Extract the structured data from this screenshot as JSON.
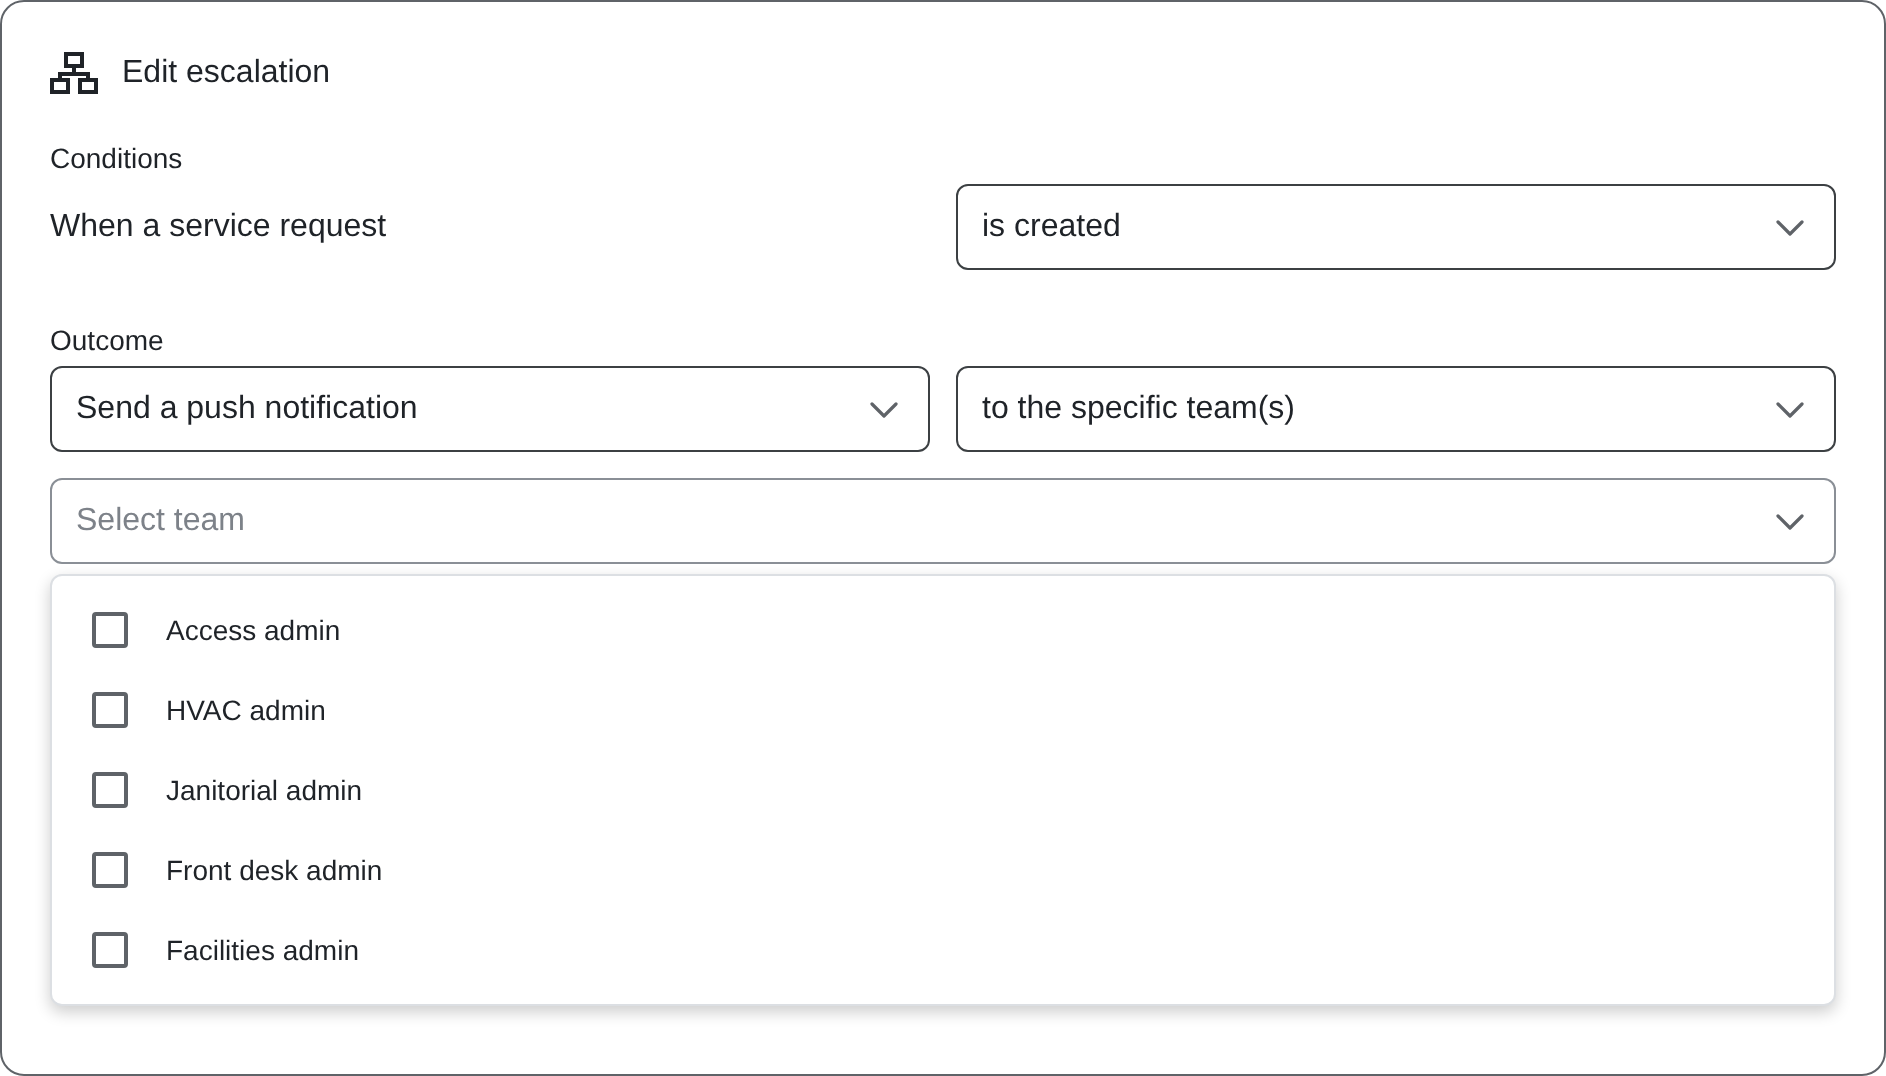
{
  "header": {
    "title": "Edit escalation"
  },
  "conditions": {
    "heading": "Conditions",
    "label": "When a service request",
    "select": {
      "value": "is created"
    }
  },
  "outcome": {
    "heading": "Outcome",
    "action_select": {
      "value": "Send a push notification"
    },
    "target_select": {
      "value": "to the specific team(s)"
    },
    "team_select": {
      "placeholder": "Select team",
      "expanded": true
    }
  },
  "team_options": [
    {
      "label": "Access admin",
      "checked": false
    },
    {
      "label": "HVAC admin",
      "checked": false
    },
    {
      "label": "Janitorial admin",
      "checked": false
    },
    {
      "label": "Front desk admin",
      "checked": false
    },
    {
      "label": "Facilities admin",
      "checked": false
    }
  ]
}
